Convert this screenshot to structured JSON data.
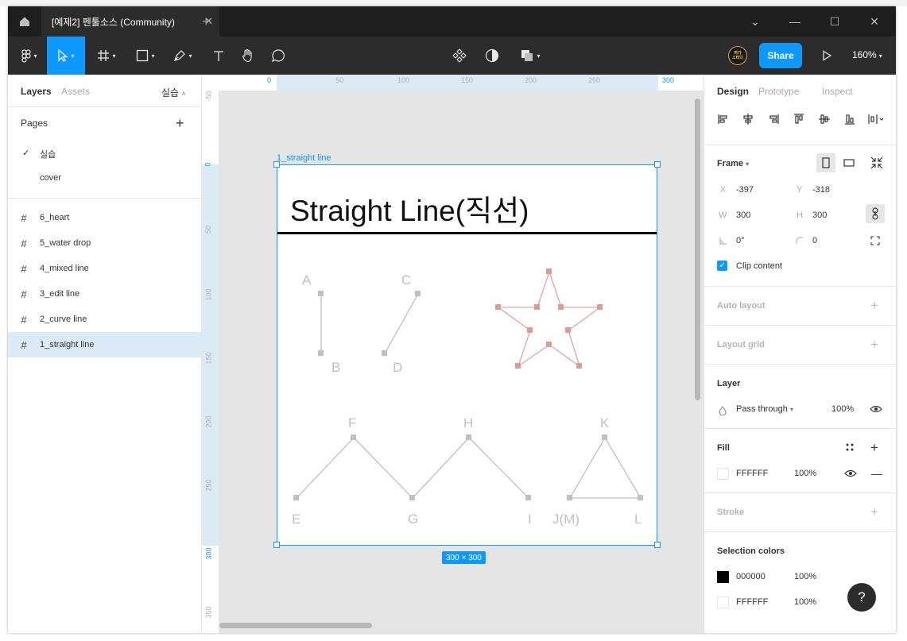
{
  "window": {
    "tab_title": "[예제2] 펜툴소스 (Community)",
    "close_tab": "✕",
    "new_tab": "+",
    "minimize": "—",
    "maximize": "☐",
    "close": "✕",
    "chevron": "⌄"
  },
  "toolbar": {
    "share_label": "Share",
    "zoom_label": "160%",
    "avatar_text": "퍼가\n스터디",
    "accent_color": "#0d99ff"
  },
  "left_panel": {
    "tabs": [
      "Layers",
      "Assets"
    ],
    "current_page_label": "실습",
    "pages_title": "Pages",
    "pages": [
      {
        "label": "실습",
        "selected": true
      },
      {
        "label": "cover",
        "selected": false
      }
    ],
    "layers": [
      {
        "label": "6_heart",
        "selected": false
      },
      {
        "label": "5_water drop",
        "selected": false
      },
      {
        "label": "4_mixed line",
        "selected": false
      },
      {
        "label": "3_edit line",
        "selected": false
      },
      {
        "label": "2_curve line",
        "selected": false
      },
      {
        "label": "1_straight line",
        "selected": true
      }
    ]
  },
  "canvas": {
    "ruler_top_labels": [
      "0",
      "50",
      "100",
      "150",
      "200",
      "250",
      "300"
    ],
    "ruler_left_labels": [
      "-50",
      "0",
      "50",
      "100",
      "150",
      "200",
      "250",
      "300",
      "350"
    ],
    "frame_name": "1_straight line",
    "frame_title": "Straight Line(직선)",
    "frame_size_badge": "300 × 300",
    "point_labels": {
      "A": "A",
      "B": "B",
      "C": "C",
      "D": "D",
      "E": "E",
      "F": "F",
      "G": "G",
      "H": "H",
      "I": "I",
      "JM": "J(M)",
      "K": "K",
      "L": "L"
    },
    "star_color": "#e3a3a0",
    "line_color": "#c0c0c0"
  },
  "right_panel": {
    "tabs": [
      "Design",
      "Prototype",
      "Inspect"
    ],
    "frame_label": "Frame",
    "x_label": "X",
    "x_value": "-397",
    "y_label": "Y",
    "y_value": "-318",
    "w_label": "W",
    "w_value": "300",
    "h_label": "H",
    "h_value": "300",
    "rotation_value": "0°",
    "radius_value": "0",
    "clip_content_label": "Clip content",
    "auto_layout_label": "Auto layout",
    "layout_grid_label": "Layout grid",
    "layer_label": "Layer",
    "blend_mode": "Pass through",
    "layer_opacity": "100%",
    "fill_label": "Fill",
    "fill_hex": "FFFFFF",
    "fill_opacity": "100%",
    "stroke_label": "Stroke",
    "selection_colors_label": "Selection colors",
    "selection_colors": [
      {
        "hex": "000000",
        "opacity": "100%",
        "color": "#000000"
      },
      {
        "hex": "FFFFFF",
        "opacity": "100%",
        "color": "#ffffff"
      }
    ],
    "help_label": "?"
  }
}
